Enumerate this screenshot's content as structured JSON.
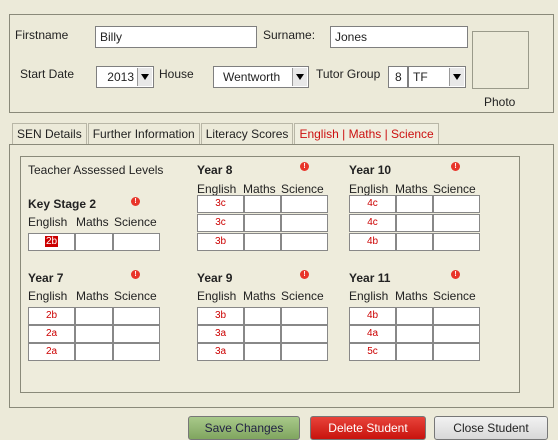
{
  "student": {
    "firstname_label": "Firstname",
    "firstname": "Billy",
    "surname_label": "Surname:",
    "surname": "Jones",
    "start_date_label": "Start Date",
    "start_date": "2013",
    "house_label": "House",
    "house": "Wentworth",
    "tutor_group_label": "Tutor Group",
    "tutor_group_year": "8",
    "tutor_group_form": "TF",
    "photo_label": "Photo"
  },
  "tabs": [
    {
      "label": "SEN Details",
      "active": false
    },
    {
      "label": "Further Information",
      "active": false
    },
    {
      "label": "Literacy Scores",
      "active": false
    },
    {
      "label": "English | Maths | Science",
      "active": true
    }
  ],
  "levels": {
    "heading": "Teacher Assessed Levels",
    "info_icon": "info-icon",
    "col_english": "English",
    "col_maths": "Maths",
    "col_science": "Science",
    "key_stage_2": {
      "title": "Key Stage 2",
      "rows": [
        [
          "2b",
          "",
          ""
        ]
      ]
    },
    "year7": {
      "title": "Year 7",
      "rows": [
        [
          "2b",
          "",
          ""
        ],
        [
          "2a",
          "",
          ""
        ],
        [
          "2a",
          "",
          ""
        ]
      ]
    },
    "year8": {
      "title": "Year 8",
      "rows": [
        [
          "3c",
          "",
          ""
        ],
        [
          "3c",
          "",
          ""
        ],
        [
          "3b",
          "",
          ""
        ]
      ]
    },
    "year9": {
      "title": "Year 9",
      "rows": [
        [
          "3b",
          "",
          ""
        ],
        [
          "3a",
          "",
          ""
        ],
        [
          "3a",
          "",
          ""
        ]
      ]
    },
    "year10": {
      "title": "Year 10",
      "rows": [
        [
          "4c",
          "",
          ""
        ],
        [
          "4c",
          "",
          ""
        ],
        [
          "4b",
          "",
          ""
        ]
      ]
    },
    "year11": {
      "title": "Year 11",
      "rows": [
        [
          "4b",
          "",
          ""
        ],
        [
          "4a",
          "",
          ""
        ],
        [
          "5c",
          "",
          ""
        ]
      ]
    }
  },
  "buttons": {
    "save": "Save Changes",
    "delete": "Delete Student",
    "close": "Close Student"
  },
  "colors": {
    "active_tab": "#cc1111",
    "level_text": "#cc0000",
    "save_button": "#8fb36e",
    "delete_button": "#d9241c"
  }
}
